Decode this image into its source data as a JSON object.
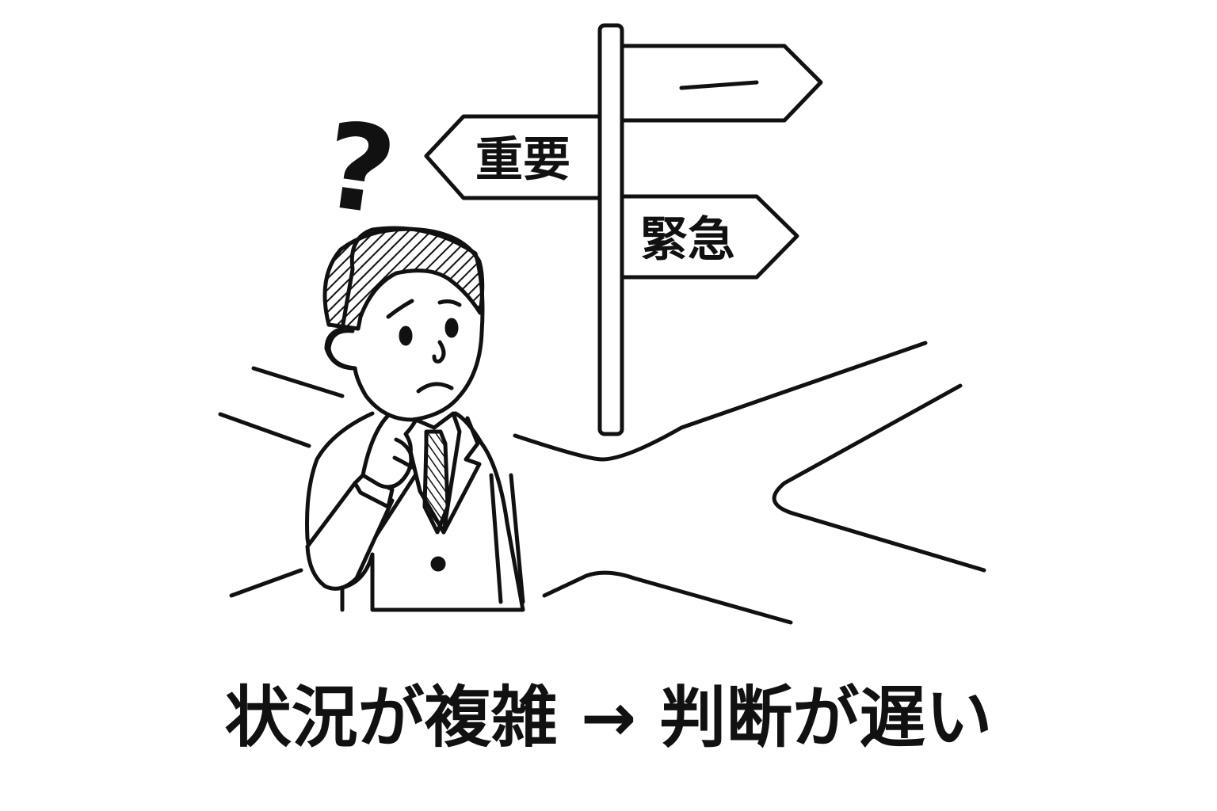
{
  "signpost": {
    "top_sign_label": "",
    "left_sign_label": "重要",
    "right_sign_label": "緊急"
  },
  "thought": {
    "question_mark": "?"
  },
  "caption": {
    "text": "状況が複雑 → 判断が遅い"
  },
  "colors": {
    "ink": "#111111",
    "background": "#ffffff"
  }
}
